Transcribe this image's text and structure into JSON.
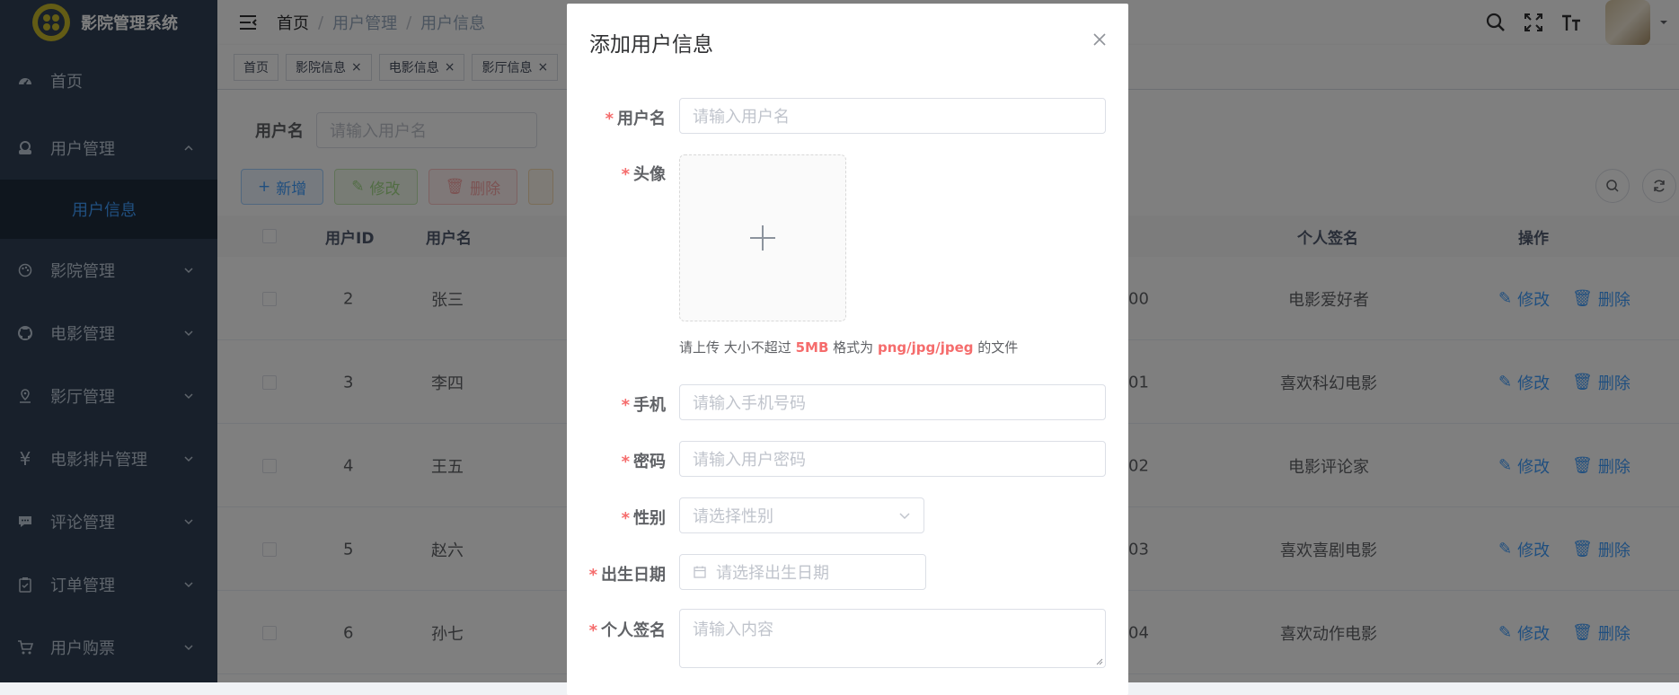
{
  "app": {
    "title": "影院管理系统"
  },
  "colors": {
    "sidebar_bg": "#304156",
    "accent": "#409eff",
    "danger": "#f56c6c",
    "success": "#67c23a",
    "warning": "#e6a23c"
  },
  "sidebar": {
    "items": [
      {
        "label": "首页",
        "icon": "dashboard-icon"
      },
      {
        "label": "用户管理",
        "icon": "user-icon",
        "expanded": true,
        "children": [
          {
            "label": "用户信息",
            "active": true
          }
        ]
      },
      {
        "label": "影院管理",
        "icon": "palette-icon"
      },
      {
        "label": "电影管理",
        "icon": "github-icon"
      },
      {
        "label": "影厅管理",
        "icon": "location-icon"
      },
      {
        "label": "电影排片管理",
        "icon": "yen-icon"
      },
      {
        "label": "评论管理",
        "icon": "comment-icon"
      },
      {
        "label": "订单管理",
        "icon": "clipboard-icon"
      },
      {
        "label": "用户购票",
        "icon": "cart-icon"
      }
    ]
  },
  "header": {
    "breadcrumb": [
      "首页",
      "用户管理",
      "用户信息"
    ],
    "tools": [
      "search-icon",
      "fullscreen-icon",
      "font-size-icon"
    ]
  },
  "tagsview": {
    "tags": [
      {
        "label": "首页",
        "closable": false
      },
      {
        "label": "影院信息",
        "closable": true
      },
      {
        "label": "电影信息",
        "closable": true
      },
      {
        "label": "影厅信息",
        "closable": true
      }
    ],
    "close_glyph": "×"
  },
  "search": {
    "label": "用户名",
    "placeholder": "请输入用户名"
  },
  "toolbar": {
    "add": "新增",
    "edit": "修改",
    "delete": "删除"
  },
  "table": {
    "columns": {
      "id": "用户ID",
      "username": "用户名",
      "signature": "个人签名",
      "actions": "操作"
    },
    "rows": [
      {
        "id": "2",
        "username": "张三",
        "partial": "00",
        "signature": "电影爱好者"
      },
      {
        "id": "3",
        "username": "李四",
        "partial": "01",
        "signature": "喜欢科幻电影"
      },
      {
        "id": "4",
        "username": "王五",
        "partial": "02",
        "signature": "电影评论家"
      },
      {
        "id": "5",
        "username": "赵六",
        "partial": "03",
        "signature": "喜欢喜剧电影"
      },
      {
        "id": "6",
        "username": "孙七",
        "partial": "04",
        "signature": "喜欢动作电影"
      }
    ],
    "row_edit": "修改",
    "row_delete": "删除"
  },
  "dialog": {
    "title": "添加用户信息",
    "required_mark": "*",
    "fields": {
      "username": {
        "label": "用户名",
        "placeholder": "请输入用户名"
      },
      "avatar": {
        "label": "头像"
      },
      "phone": {
        "label": "手机",
        "placeholder": "请输入手机号码"
      },
      "password": {
        "label": "密码",
        "placeholder": "请输入用户密码"
      },
      "gender": {
        "label": "性别",
        "placeholder": "请选择性别"
      },
      "birthday": {
        "label": "出生日期",
        "placeholder": "请选择出生日期"
      },
      "signature": {
        "label": "个人签名",
        "placeholder": "请输入内容"
      }
    },
    "upload_tip": {
      "prefix": "请上传",
      "size_text": "大小不超过",
      "size": "5MB",
      "format_text": "格式为",
      "formats": "png/jpg/jpeg",
      "suffix": "的文件"
    }
  }
}
